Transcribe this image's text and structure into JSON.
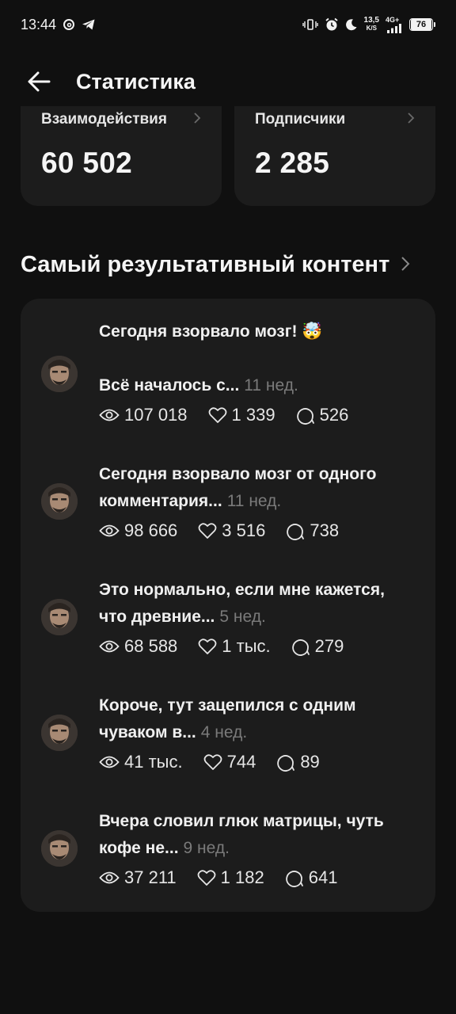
{
  "status_bar": {
    "time": "13:44",
    "left_icons": [
      "threads-icon",
      "telegram-icon"
    ],
    "right_icons": [
      "vibrate-icon",
      "alarm-icon",
      "moon-icon"
    ],
    "speed_value": "13,5",
    "speed_unit": "K/S",
    "network": "4G+",
    "battery": "76"
  },
  "header": {
    "title": "Статистика",
    "back_icon": "arrow-left-icon"
  },
  "stats": [
    {
      "label": "Взаимодействия",
      "value": "60 502"
    },
    {
      "label": "Подписчики",
      "value": "2 285"
    }
  ],
  "section": {
    "title": "Самый результативный контент"
  },
  "posts": [
    {
      "lines": [
        "Сегодня взорвало мозг! 🤯",
        "",
        "Всё началось с..."
      ],
      "ago": "11 нед.",
      "views": "107 018",
      "likes": "1 339",
      "comments": "526"
    },
    {
      "lines": [
        "Сегодня взорвало мозг от одного",
        "комментария..."
      ],
      "ago": "11 нед.",
      "views": "98 666",
      "likes": "3 516",
      "comments": "738"
    },
    {
      "lines": [
        "Это нормально, если мне кажется,",
        "что древние..."
      ],
      "ago": "5 нед.",
      "views": "68 588",
      "likes": "1 тыс.",
      "comments": "279"
    },
    {
      "lines": [
        "Короче, тут зацепился с одним",
        "чуваком в..."
      ],
      "ago": "4 нед.",
      "views": "41 тыс.",
      "likes": "744",
      "comments": "89"
    },
    {
      "lines": [
        "Вчера словил глюк матрицы, чуть",
        "кофе не..."
      ],
      "ago": "9 нед.",
      "views": "37 211",
      "likes": "1 182",
      "comments": "641"
    }
  ],
  "colors": {
    "background": "#101010",
    "card": "#1c1c1c",
    "text": "#f2f2f2",
    "muted": "#7a7a7a"
  }
}
